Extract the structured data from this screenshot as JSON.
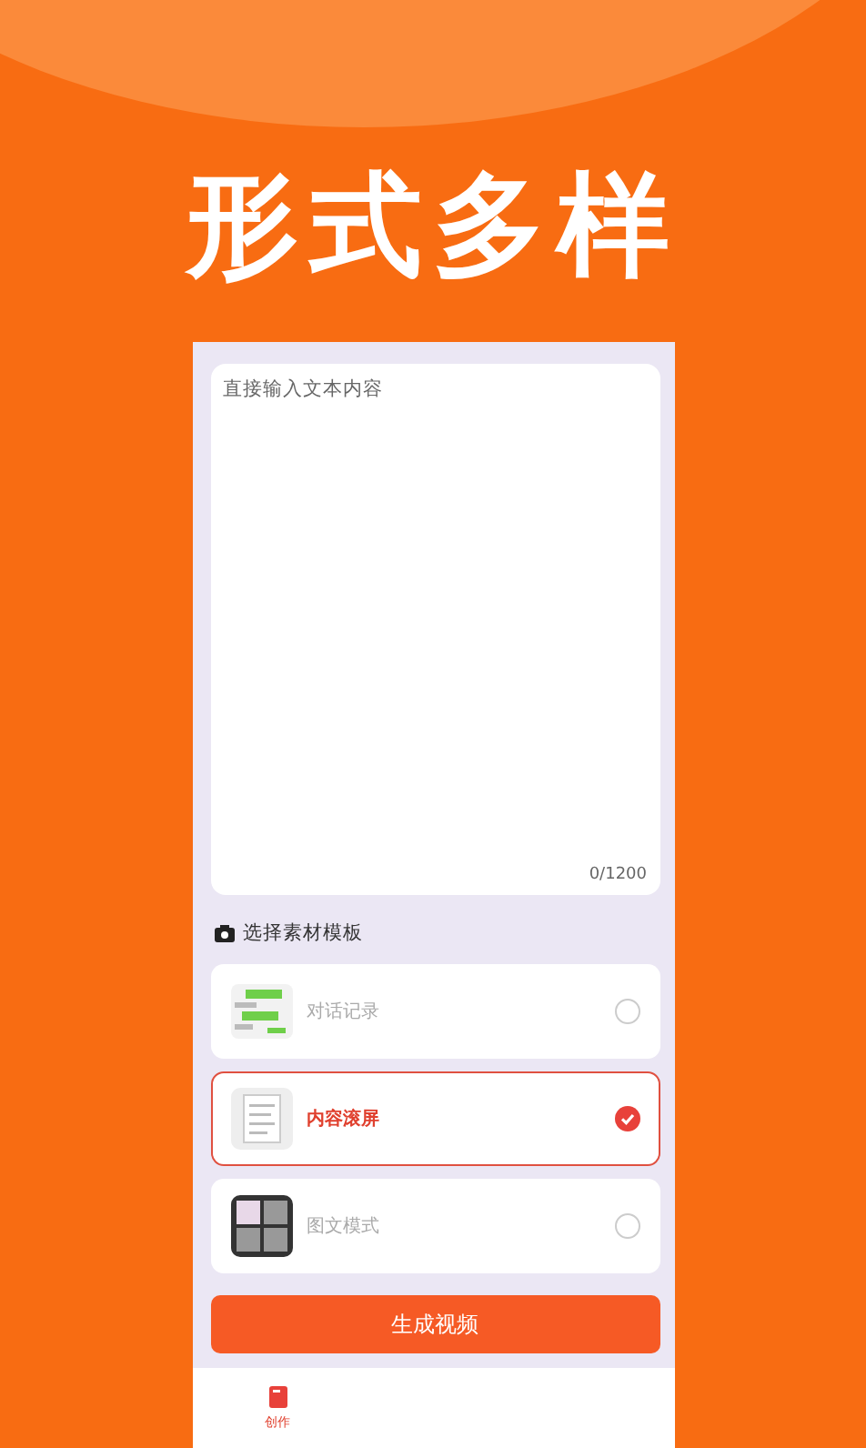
{
  "headline": "形式多样",
  "text_input": {
    "placeholder": "直接输入文本内容",
    "counter": "0/1200"
  },
  "template_section": {
    "title": "选择素材模板"
  },
  "templates": [
    {
      "kind": "chat",
      "label": "对话记录",
      "selected": false
    },
    {
      "kind": "scroll",
      "label": "内容滚屏",
      "selected": true
    },
    {
      "kind": "grid",
      "label": "图文模式",
      "selected": false
    }
  ],
  "generate_button": "生成视频",
  "bottom_nav": [
    {
      "label": "创作",
      "selected": true
    }
  ]
}
